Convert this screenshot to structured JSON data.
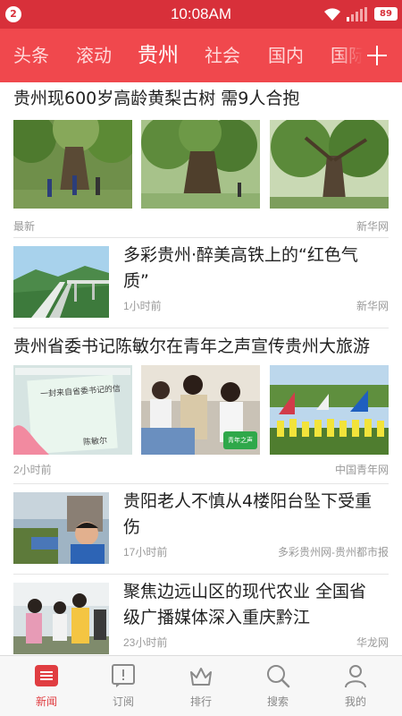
{
  "status_bar": {
    "notification_count": "2",
    "time": "10:08AM",
    "battery": "89"
  },
  "channels": [
    "头条",
    "滚动",
    "贵州",
    "社会",
    "国内",
    "国际"
  ],
  "active_channel": "贵州",
  "feed": [
    {
      "title": "贵州现600岁高龄黄梨古树 需9人合抱",
      "time": "最新",
      "source": "新华网",
      "layout": "three-images"
    },
    {
      "title": "多彩贵州·醉美高铁上的“红色气质”",
      "title_line1": "多彩贵州·醉美高铁上的“红色气",
      "title_line2": "质”",
      "time": "1小时前",
      "source": "新华网",
      "layout": "single-image"
    },
    {
      "title": "贵州省委书记陈敏尔在青年之声宣传贵州大旅游",
      "time": "2小时前",
      "source": "中国青年网",
      "layout": "three-images",
      "image_text": {
        "letter": "一封来自省委书记的信",
        "signature": "陈敏尔",
        "badge": "青年之声"
      }
    },
    {
      "title": "贵阳老人不慎从4楼阳台坠下受重伤",
      "title_line1": "贵阳老人不慎从4楼阳台坠下受重",
      "title_line2": "伤",
      "time": "17小时前",
      "source": "多彩贵州网-贵州都市报",
      "layout": "single-image"
    },
    {
      "title": "聚焦边远山区的现代农业 全国省级广播媒体深入重庆黔江",
      "title_line1": "聚焦边远山区的现代农业 全国省",
      "title_line2": "级广播媒体深入重庆黔江",
      "time": "23小时前",
      "source": "华龙网",
      "layout": "single-image"
    }
  ],
  "tabs": [
    {
      "label": "新闻",
      "icon": "news-icon",
      "active": true
    },
    {
      "label": "订阅",
      "icon": "subscribe-icon",
      "active": false
    },
    {
      "label": "排行",
      "icon": "crown-icon",
      "active": false
    },
    {
      "label": "搜索",
      "icon": "search-icon",
      "active": false
    },
    {
      "label": "我的",
      "icon": "profile-icon",
      "active": false
    }
  ],
  "colors": {
    "status_bar": "#d8303a",
    "channel_bar": "#f0484d",
    "active_tab": "#e03d41"
  }
}
